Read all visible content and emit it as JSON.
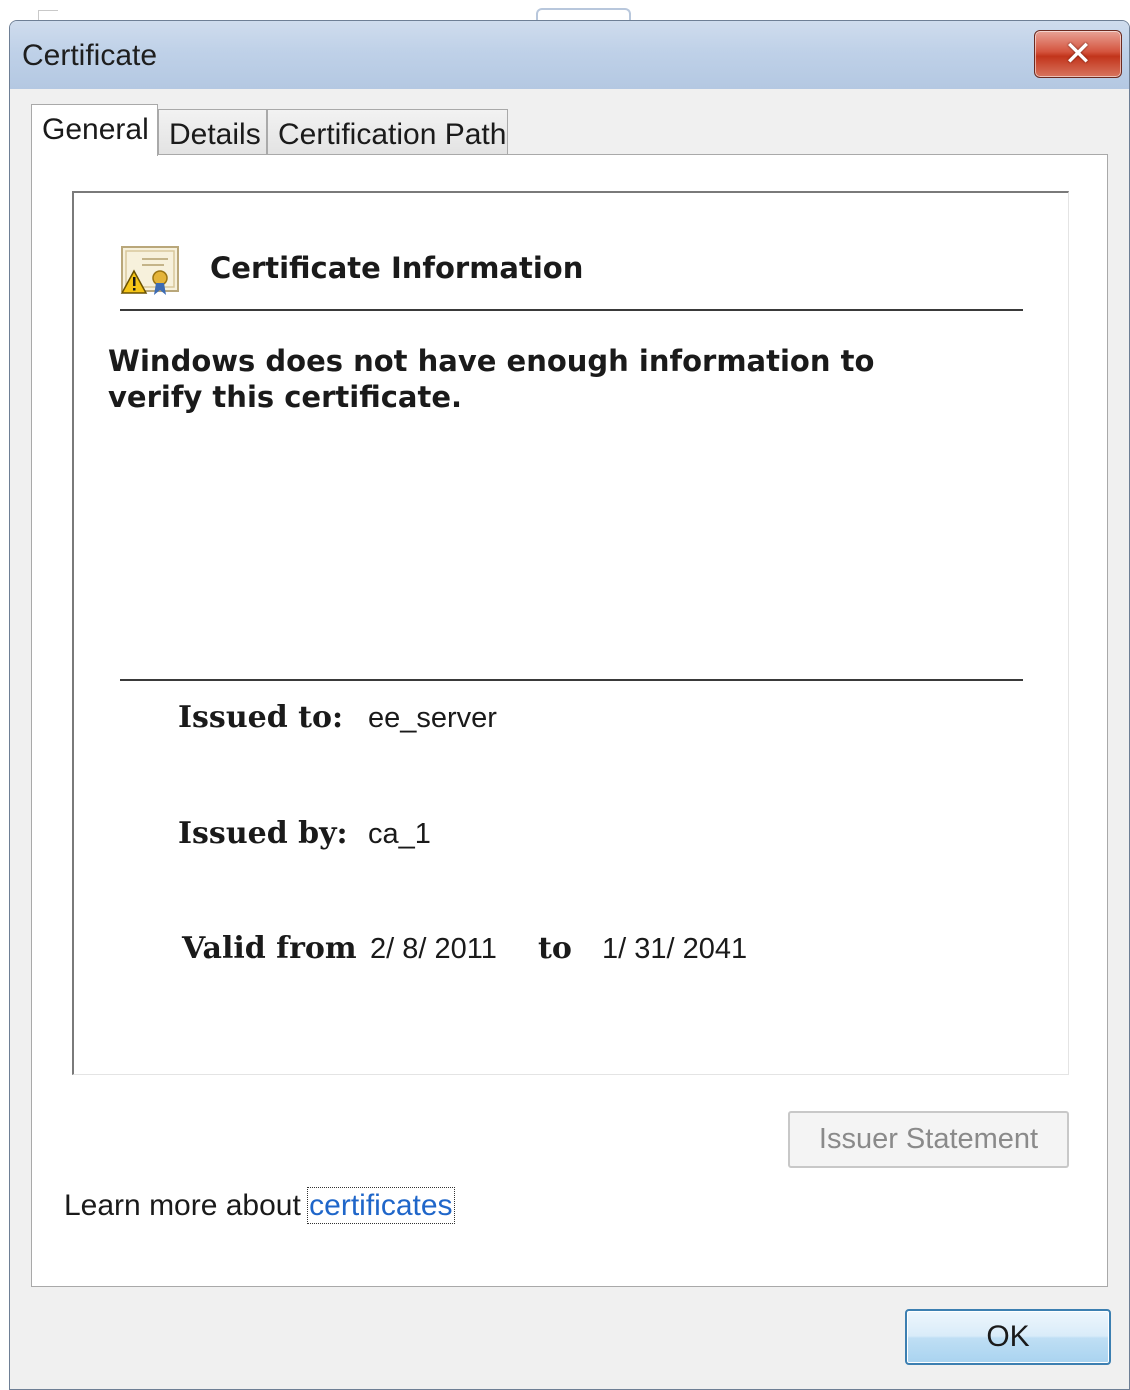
{
  "window": {
    "title": "Certificate",
    "close_icon": "close-icon",
    "close_glyph": "✕"
  },
  "tabs": [
    {
      "label": "General",
      "active": true
    },
    {
      "label": "Details",
      "active": false
    },
    {
      "label": "Certification Path",
      "active": false
    }
  ],
  "info": {
    "icon": "certificate-warning-icon",
    "title": "Certificate Information",
    "warning": "Windows does not have enough information to verify this certificate.",
    "issued_to_label": "Issued to:",
    "issued_to_value": "ee_server",
    "issued_by_label": "Issued by:",
    "issued_by_value": "ca_1",
    "valid_from_label": "Valid from",
    "valid_from_value": "2/ 8/ 2011",
    "to_label": "to",
    "valid_to_value": "1/ 31/ 2041"
  },
  "buttons": {
    "issuer_statement": "Issuer Statement",
    "ok": "OK"
  },
  "learn_more": {
    "prefix": "Learn more about ",
    "link": "certificates"
  },
  "colors": {
    "link": "#1f66c9",
    "close_button": "#c9412a",
    "title_bar": "#bfd1e8"
  }
}
